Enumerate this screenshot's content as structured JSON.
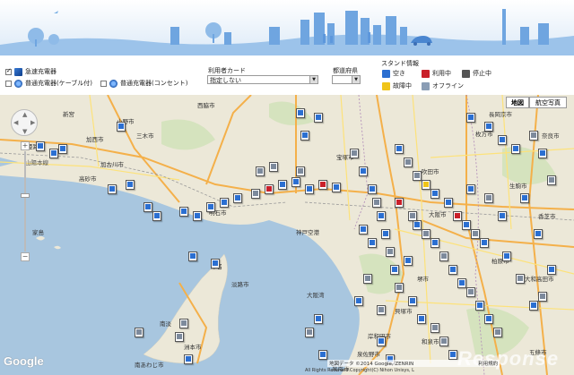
{
  "filters": {
    "charger_types": [
      {
        "label": "急速充電器",
        "checked": true
      },
      {
        "label": "普通充電器(ケーブル付)",
        "checked": false
      },
      {
        "label": "普通充電器(コンセント)",
        "checked": false
      }
    ],
    "card_label": "利用者カード",
    "card_value": "指定しない",
    "pref_label": "都道府県",
    "pref_value": "",
    "status_label": "スタンド情報",
    "status_items": [
      "空き",
      "利用中",
      "停止中",
      "故障中",
      "オフライン"
    ]
  },
  "map": {
    "type_buttons": [
      "地図",
      "航空写真"
    ],
    "zoom_in": "+",
    "zoom_out": "−",
    "attribution": "地図データ ©2014 Google, ZENRIN",
    "terms": "利用規約",
    "google_logo": "Google",
    "copyright": "All Rights Reserved.Copyright(C) Nihon Unisys, L",
    "watermark": "Response",
    "labels": {
      "himeji": "姫路市",
      "sanyo": "山陽本線",
      "kakogawa": "加古川市",
      "takasago": "高砂市",
      "akashi": "明石市",
      "kobe": "神戸空港",
      "osaka_bay": "大阪湾",
      "miki": "三木市",
      "ono": "小野市",
      "takarazuka": "宝塚市",
      "kashiwara": "柏原市",
      "kishiwada": "岸和田市",
      "sennan": "泉南市",
      "izumi": "和泉市",
      "gojo": "五條市",
      "nara": "奈良市",
      "kyotanabe": "京田辺市",
      "ikoma": "生駒市",
      "yamato": "大和高田市",
      "kashiba": "香芝市",
      "sumoto": "洲本市",
      "awaji": "淡路市",
      "ieshima": "家島",
      "kaifu": "貝塚市",
      "hirakata": "枚方市",
      "shin": "新宮",
      "nandan": "南淡",
      "minami": "南あわじ市",
      "nishiwaki": "西脇市",
      "kasai": "加西市",
      "sakai": "堺市",
      "izumisano": "泉佐野市",
      "tsuna": "津名",
      "kyoto": "長岡京市",
      "osaka": "大阪市",
      "suita": "吹田市"
    }
  }
}
